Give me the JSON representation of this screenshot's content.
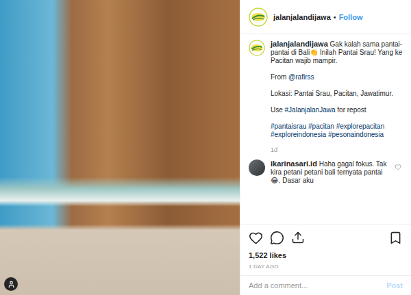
{
  "header": {
    "username": "jalanjalandijawa",
    "separator": "•",
    "follow": "Follow"
  },
  "caption": {
    "username": "jalanjalandijawa",
    "paragraphs": [
      [
        {
          "text": "Gak kalah sama pantai-pantai di Bali👏 Inilah Pantai Srau! Yang ke Pacitan wajib mampir.",
          "link": false
        }
      ],
      [
        {
          "text": "From ",
          "link": false
        },
        {
          "text": "@rafirss",
          "link": true
        }
      ],
      [
        {
          "text": "Lokasi: Pantai Srau, Pacitan, Jawatimur.",
          "link": false
        }
      ],
      [
        {
          "text": "Use ",
          "link": false
        },
        {
          "text": "#JalanjalanJawa",
          "link": true
        },
        {
          "text": " for repost",
          "link": false
        }
      ],
      [
        {
          "text": "#pantaisrau #pacitan #explorepacitan #exploreindonesia #pesonaindonesia",
          "link": true
        }
      ]
    ],
    "age": "1d"
  },
  "comments": [
    {
      "username": "ikarinasari.id",
      "text": "Haha gagal fokus. Tak kira petani petani bali ternyata pantai😂. Dasar aku",
      "liked": false
    }
  ],
  "likes": "1,522 likes",
  "time": "1 DAY AGO",
  "comment_box": {
    "placeholder": "Add a comment...",
    "button": "Post",
    "disabled": true
  }
}
